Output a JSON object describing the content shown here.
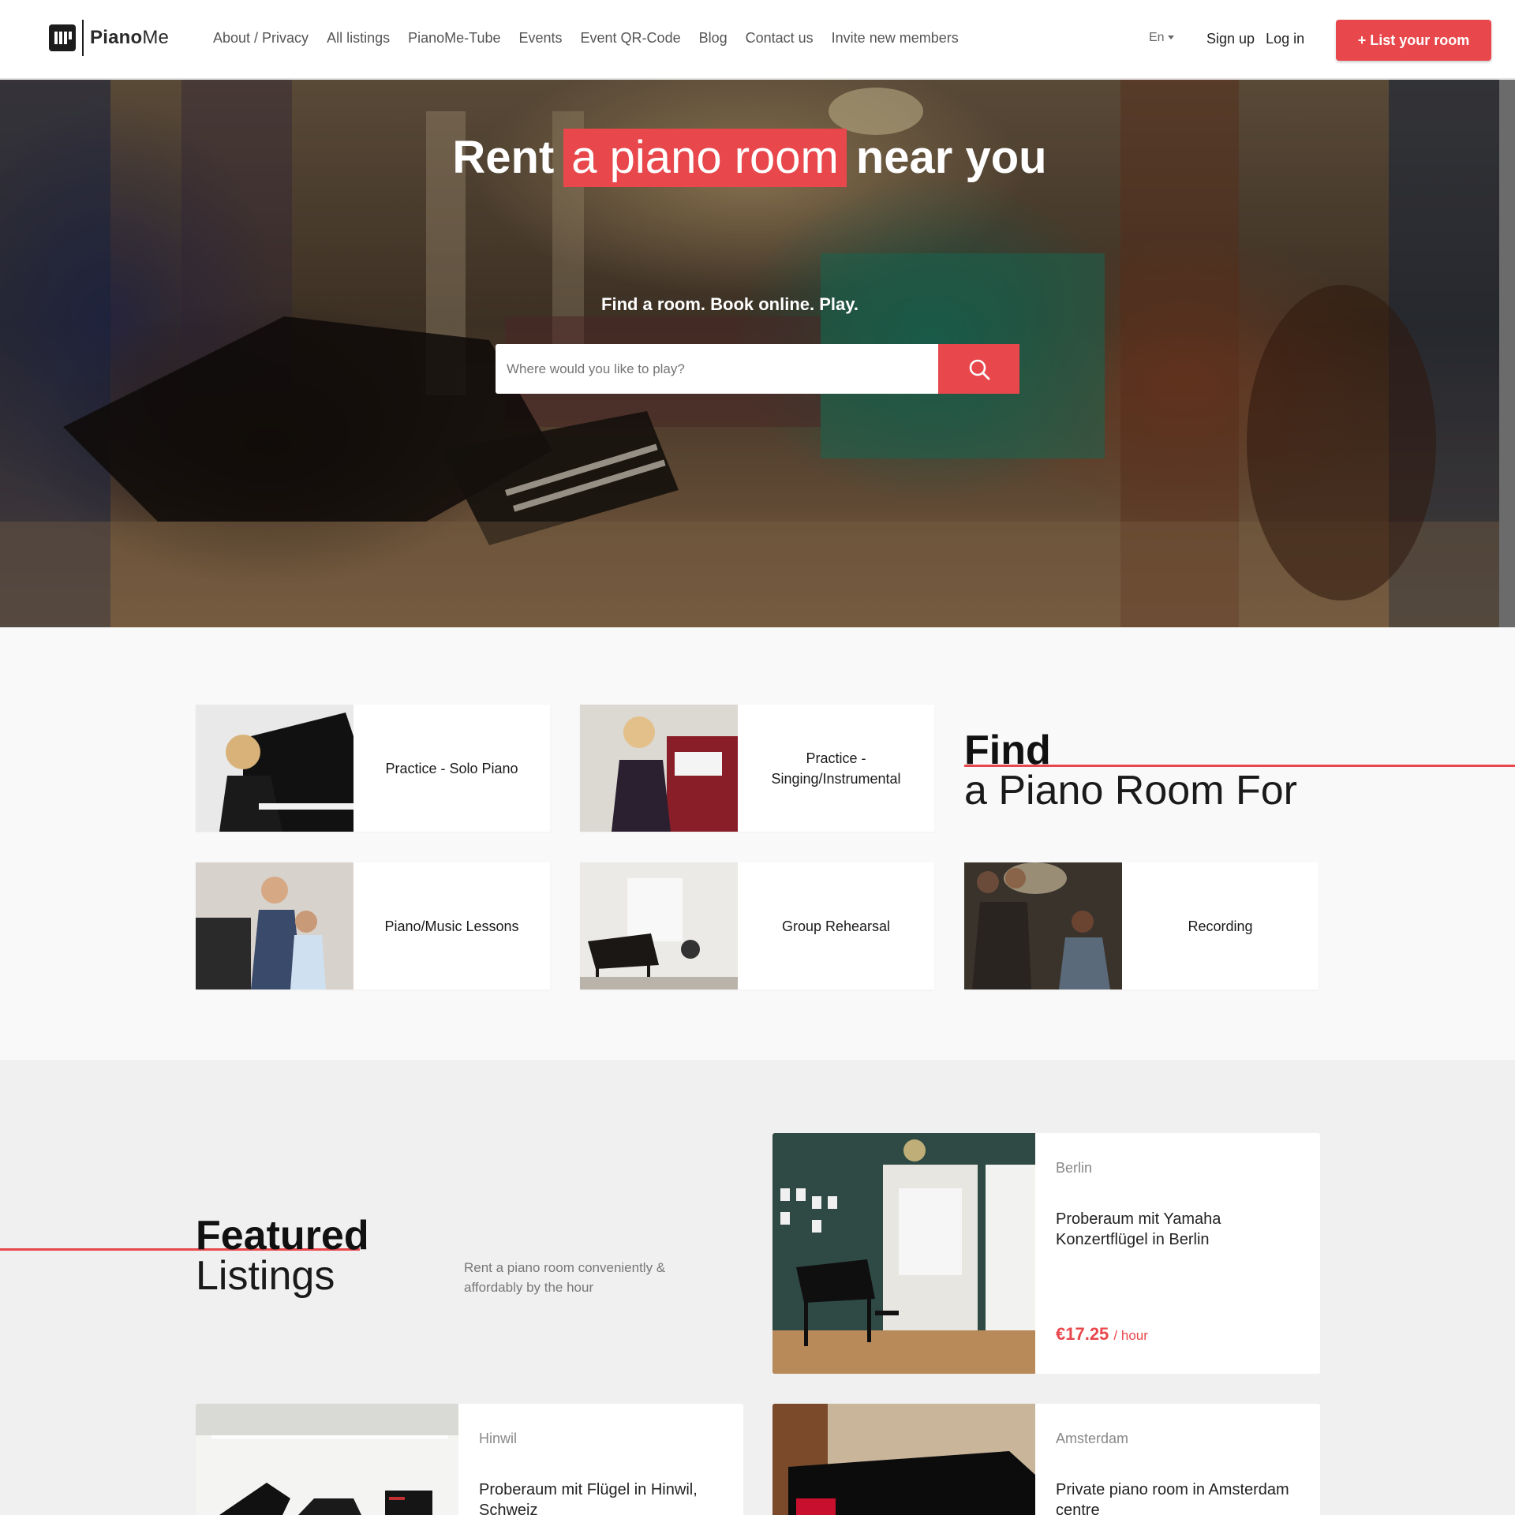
{
  "header": {
    "logo_text_a": "Piano",
    "logo_text_b": "Me",
    "nav": [
      "About / Privacy",
      "All listings",
      "PianoMe-Tube",
      "Events",
      "Event QR-Code",
      "Blog",
      "Contact us",
      "Invite new members"
    ],
    "language": "En",
    "sign_up": "Sign up",
    "log_in": "Log in",
    "cta": "+ List your room"
  },
  "hero": {
    "title_pre": "Rent",
    "title_highlight": "a piano room",
    "title_post": "near you",
    "subtitle": "Find a room. Book online. Play.",
    "search_placeholder": "Where would you like to play?",
    "search_icon": "search-icon"
  },
  "categories": {
    "heading_bold": "Find",
    "heading_light": "a Piano Room For",
    "items": [
      {
        "label": "Practice - Solo Piano"
      },
      {
        "label": "Practice - Singing/Instrumental"
      },
      {
        "label": "Piano/Music Lessons"
      },
      {
        "label": "Group Rehearsal"
      },
      {
        "label": "Recording"
      }
    ]
  },
  "featured": {
    "heading_bold": "Featured",
    "heading_light": "Listings",
    "subtitle": "Rent a piano room conveniently & affordably by the hour",
    "listings": [
      {
        "city": "Berlin",
        "title": "Proberaum mit Yamaha Konzertflügel in Berlin",
        "price": "€17.25",
        "unit": "/ hour"
      },
      {
        "city": "Hinwil",
        "title": "Proberaum mit Flügel in Hinwil, Schweiz",
        "price": "",
        "unit": ""
      },
      {
        "city": "Amsterdam",
        "title": "Private piano room in Amsterdam centre",
        "price": "",
        "unit": ""
      }
    ]
  },
  "colors": {
    "accent": "#e8474c"
  }
}
